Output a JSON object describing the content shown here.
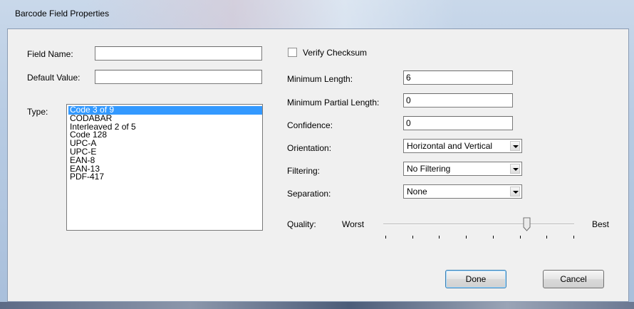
{
  "window": {
    "title": "Barcode Field Properties"
  },
  "left": {
    "field_name_label": "Field Name:",
    "field_name_value": "",
    "default_value_label": "Default Value:",
    "default_value_value": "",
    "type_label": "Type:",
    "type_options": [
      "Code 3 of 9",
      "CODABAR",
      "Interleaved 2 of 5",
      "Code 128",
      "UPC-A",
      "UPC-E",
      "EAN-8",
      "EAN-13",
      "PDF-417"
    ],
    "type_selected": "Code 3 of 9"
  },
  "right": {
    "verify_checksum_label": "Verify Checksum",
    "verify_checksum_checked": false,
    "min_length_label": "Minimum Length:",
    "min_length_value": "6",
    "min_partial_label": "Minimum Partial Length:",
    "min_partial_value": "0",
    "confidence_label": "Confidence:",
    "confidence_value": "0",
    "orientation_label": "Orientation:",
    "orientation_value": "Horizontal and Vertical",
    "filtering_label": "Filtering:",
    "filtering_value": "No Filtering",
    "separation_label": "Separation:",
    "separation_value": "None",
    "quality_label": "Quality:",
    "quality_min_label": "Worst",
    "quality_max_label": "Best",
    "quality_level": 0.75,
    "quality_steps": 8
  },
  "buttons": {
    "done": "Done",
    "cancel": "Cancel"
  }
}
